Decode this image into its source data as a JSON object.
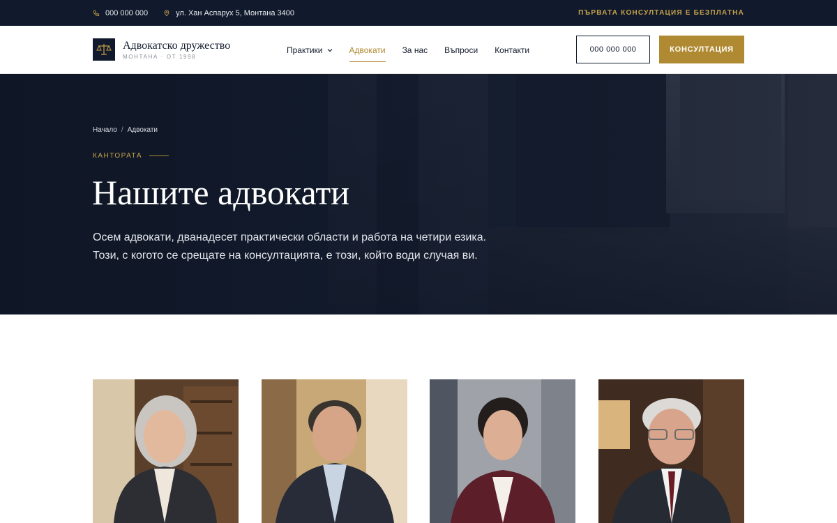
{
  "topbar": {
    "phone": "000 000 000",
    "address": "ул. Хан Аспарух 5, Монтана 3400",
    "promo": "ПЪРВАТА КОНСУЛТАЦИЯ Е БЕЗПЛАТНА"
  },
  "header": {
    "logo_name": "Адвокатско дружество",
    "logo_sub": "МОНТАНА · ОТ 1998",
    "nav": [
      {
        "label": "Практики"
      },
      {
        "label": "Адвокати"
      },
      {
        "label": "За нас"
      },
      {
        "label": "Въпроси"
      },
      {
        "label": "Контакти"
      }
    ],
    "active_nav": "Адвокати",
    "phone_button": "000 000 000",
    "cta_button": "КОНСУЛТАЦИЯ"
  },
  "hero": {
    "breadcrumb": [
      "Начало",
      "Адвокати"
    ],
    "breadcrumb_sep": "/",
    "eyebrow": "КАНТОРАТА",
    "title": "Нашите адвокати",
    "lead_line1": "Осем адвокати, дванадесет практически области и работа на четири езика.",
    "lead_line2": "Този, с когото се срещате на консултацията, е този, който води случая ви."
  },
  "team": [
    {
      "photo": "lawyer-portrait-1"
    },
    {
      "photo": "lawyer-portrait-2"
    },
    {
      "photo": "lawyer-portrait-3"
    },
    {
      "photo": "lawyer-portrait-4"
    }
  ],
  "colors": {
    "navy": "#111a2c",
    "gold": "#b08a32",
    "gold_text": "#c7a24a",
    "white": "#ffffff"
  }
}
